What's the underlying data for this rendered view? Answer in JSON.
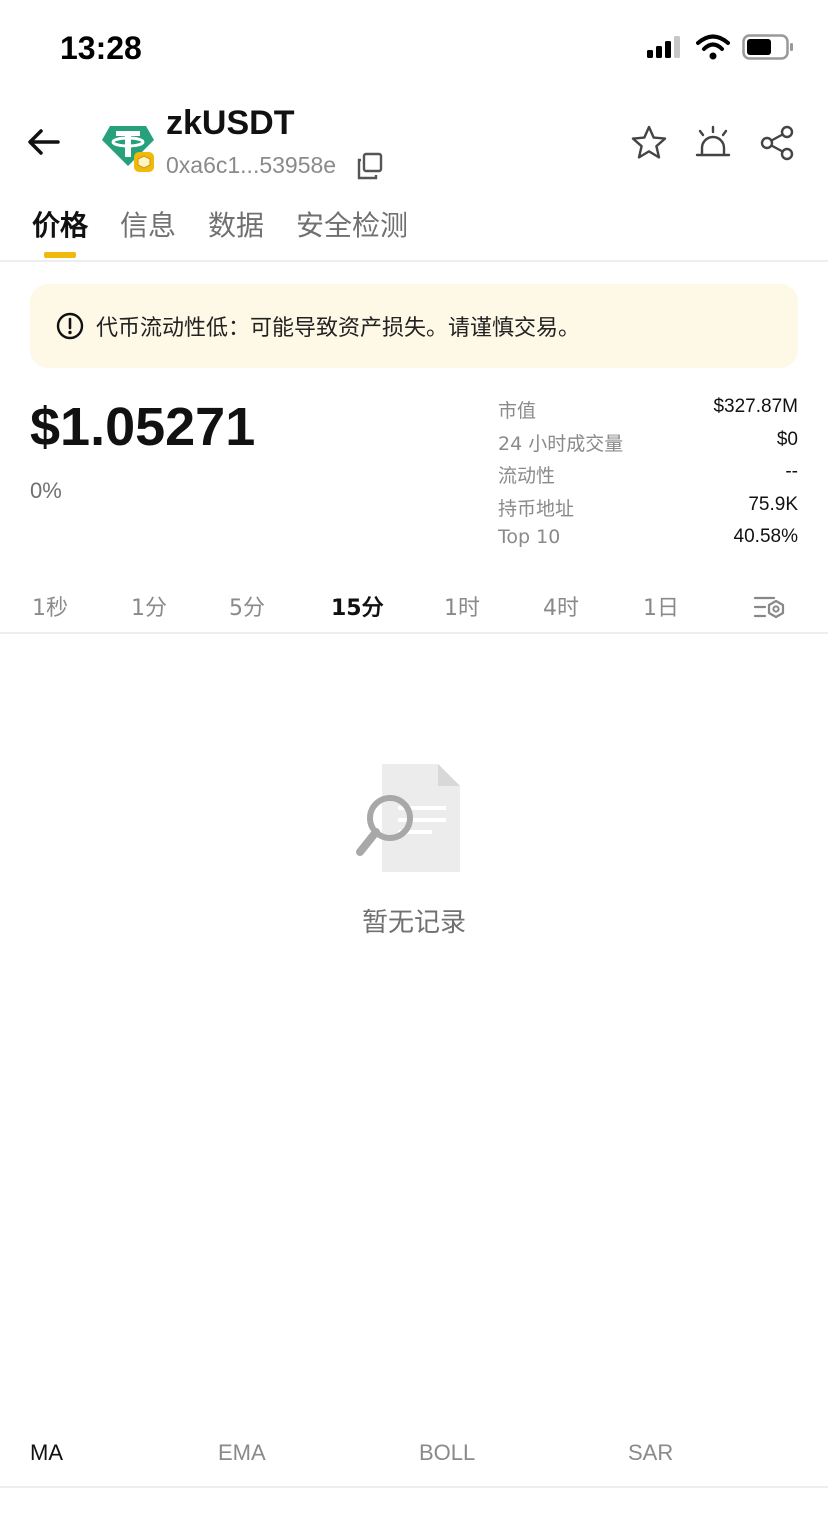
{
  "status_bar": {
    "time": "13:28"
  },
  "header": {
    "token_name": "zkUSDT",
    "token_address": "0xa6c1...53958e"
  },
  "tabs": [
    {
      "label": "价格",
      "active": true
    },
    {
      "label": "信息",
      "active": false
    },
    {
      "label": "数据",
      "active": false
    },
    {
      "label": "安全检测",
      "active": false
    }
  ],
  "warning": {
    "text": "代币流动性低：可能导致资产损失。请谨慎交易。"
  },
  "price": {
    "value": "$1.05271",
    "change": "0%"
  },
  "stats": [
    {
      "label": "市值",
      "value": "$327.87M"
    },
    {
      "label": "24 小时成交量",
      "value": "$0"
    },
    {
      "label": "流动性",
      "value": "--"
    },
    {
      "label": "持币地址",
      "value": "75.9K"
    },
    {
      "label": "Top 10",
      "value": "40.58%"
    }
  ],
  "intervals": [
    {
      "label": "1秒",
      "active": false
    },
    {
      "label": "1分",
      "active": false
    },
    {
      "label": "5分",
      "active": false
    },
    {
      "label": "15分",
      "active": true
    },
    {
      "label": "1时",
      "active": false
    },
    {
      "label": "4时",
      "active": false
    },
    {
      "label": "1日",
      "active": false
    }
  ],
  "empty_state": {
    "text": "暂无记录"
  },
  "indicators": [
    {
      "label": "MA",
      "active": true
    },
    {
      "label": "EMA",
      "active": false
    },
    {
      "label": "BOLL",
      "active": false
    },
    {
      "label": "SAR",
      "active": false
    }
  ],
  "colors": {
    "accent": "#F0B90B",
    "tether_green": "#26A17B",
    "warning_bg": "#FEF9E6"
  }
}
